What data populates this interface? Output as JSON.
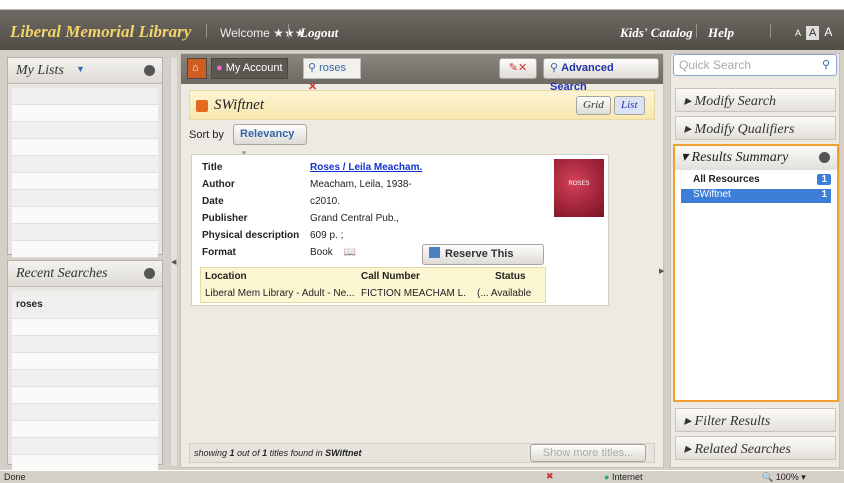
{
  "header": {
    "library_name": "Liberal Memorial Library",
    "welcome": "Welcome ★★★",
    "logout": "Logout",
    "kids_catalog": "Kids' Catalog",
    "help": "Help",
    "font_size_small": "A",
    "font_size_large": "A"
  },
  "my_lists": {
    "title": "My Lists"
  },
  "recent_searches": {
    "title": "Recent Searches",
    "items": [
      "roses"
    ]
  },
  "tabs": {
    "my_account": "My Account",
    "search_tab": "roses"
  },
  "toolbar": {
    "advanced_search": "Advanced Search",
    "quick_search_placeholder": "Quick Search"
  },
  "results": {
    "source": "SWiftnet",
    "view_grid": "Grid",
    "view_list": "List",
    "sort_label": "Sort by",
    "sort_value": "Relevancy",
    "item": {
      "fields": [
        {
          "label": "Title",
          "value": "Roses / Leila Meacham."
        },
        {
          "label": "Author",
          "value": "Meacham, Leila, 1938-"
        },
        {
          "label": "Date",
          "value": "c2010."
        },
        {
          "label": "Publisher",
          "value": "Grand Central Pub.,"
        },
        {
          "label": "Physical description",
          "value": "609 p. ;"
        },
        {
          "label": "Format",
          "value": "Book"
        }
      ],
      "cover_text": "ROSES",
      "reserve_button": "Reserve This Item",
      "holdings_headers": [
        "Location",
        "Call Number",
        "Status"
      ],
      "holdings": [
        {
          "location": "Liberal Mem Library - Adult - Ne...",
          "call_number": "FICTION MEACHAM L.",
          "status": "(... Available"
        }
      ]
    },
    "footer_prefix": "showing ",
    "footer_count": "1",
    "footer_mid": " out of ",
    "footer_total": "1",
    "footer_suffix": " titles found in ",
    "footer_source": "SWiftnet",
    "show_more": "Show more titles..."
  },
  "right_panel": {
    "modify_search": "Modify Search",
    "modify_qualifiers": "Modify Qualifiers",
    "results_summary": "Results Summary",
    "all_resources": "All Resources",
    "all_count": "1",
    "swiftnet": "SWiftnet",
    "swiftnet_count": "1",
    "filter_results": "Filter Results",
    "related_searches": "Related Searches"
  },
  "statusbar": {
    "status": "Done",
    "zone": "Internet",
    "zoom": "100%"
  }
}
